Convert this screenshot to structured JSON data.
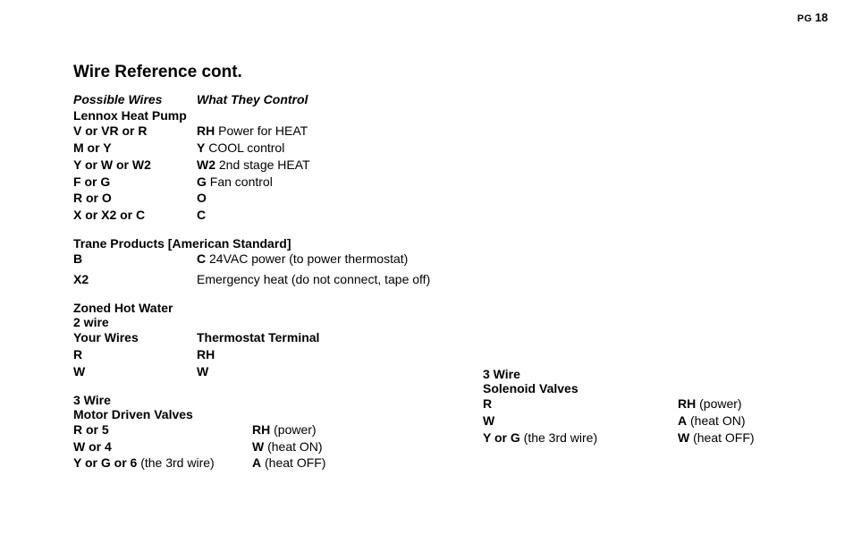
{
  "pageLabel": "PG",
  "pageNum": "18",
  "title": "Wire Reference cont.",
  "header": {
    "possible": "Possible Wires",
    "control": "What They Control"
  },
  "lennox": {
    "title": "Lennox Heat Pump",
    "rows": [
      {
        "a": "V or VR or R",
        "bKey": "RH",
        "bVal": " Power for HEAT"
      },
      {
        "a": "M or Y",
        "bKey": "Y",
        "bVal": " COOL control"
      },
      {
        "a": "Y or W or W2",
        "bKey": "W2",
        "bVal": " 2nd stage HEAT"
      },
      {
        "a": "F or G",
        "bKey": "G",
        "bVal": " Fan control"
      },
      {
        "a": "R or O",
        "bKey": "O",
        "bVal": ""
      },
      {
        "a": "X or X2 or C",
        "bKey": "C",
        "bVal": ""
      }
    ]
  },
  "trane": {
    "title": "Trane Products [American Standard]",
    "rows": [
      {
        "a": "B",
        "bKey": "C",
        "bVal": " 24VAC power (to power thermostat)"
      },
      {
        "a": "X2",
        "bKey": "",
        "bVal": "Emergency heat (do not connect, tape off)"
      }
    ]
  },
  "zoned": {
    "title1": "Zoned Hot Water",
    "title2": "2 wire",
    "hdrA": "Your Wires",
    "hdrB": "Thermostat Terminal",
    "rows": [
      {
        "a": "R",
        "b": "RH"
      },
      {
        "a": "W",
        "b": "W"
      }
    ]
  },
  "motor": {
    "title1": "3 Wire",
    "title2": "Motor Driven Valves",
    "rows": [
      {
        "a": "R or 5",
        "aNote": "",
        "bKey": "RH",
        "bVal": " (power)"
      },
      {
        "a": "W or 4",
        "aNote": "",
        "bKey": "W",
        "bVal": "  (heat ON)"
      },
      {
        "a": "Y or G or 6",
        "aNote": "  (the 3rd wire)",
        "bKey": "A",
        "bVal": "   (heat OFF)"
      }
    ]
  },
  "solenoid": {
    "title1": "3 Wire",
    "title2": "Solenoid Valves",
    "rows": [
      {
        "a": "R",
        "aNote": "",
        "bKey": "RH",
        "bVal": "  (power)"
      },
      {
        "a": "W",
        "aNote": "",
        "bKey": "A",
        "bVal": "   (heat ON)"
      },
      {
        "a": "Y or G",
        "aNote": " (the 3rd wire)",
        "bKey": "W",
        "bVal": "   (heat OFF)"
      }
    ]
  }
}
